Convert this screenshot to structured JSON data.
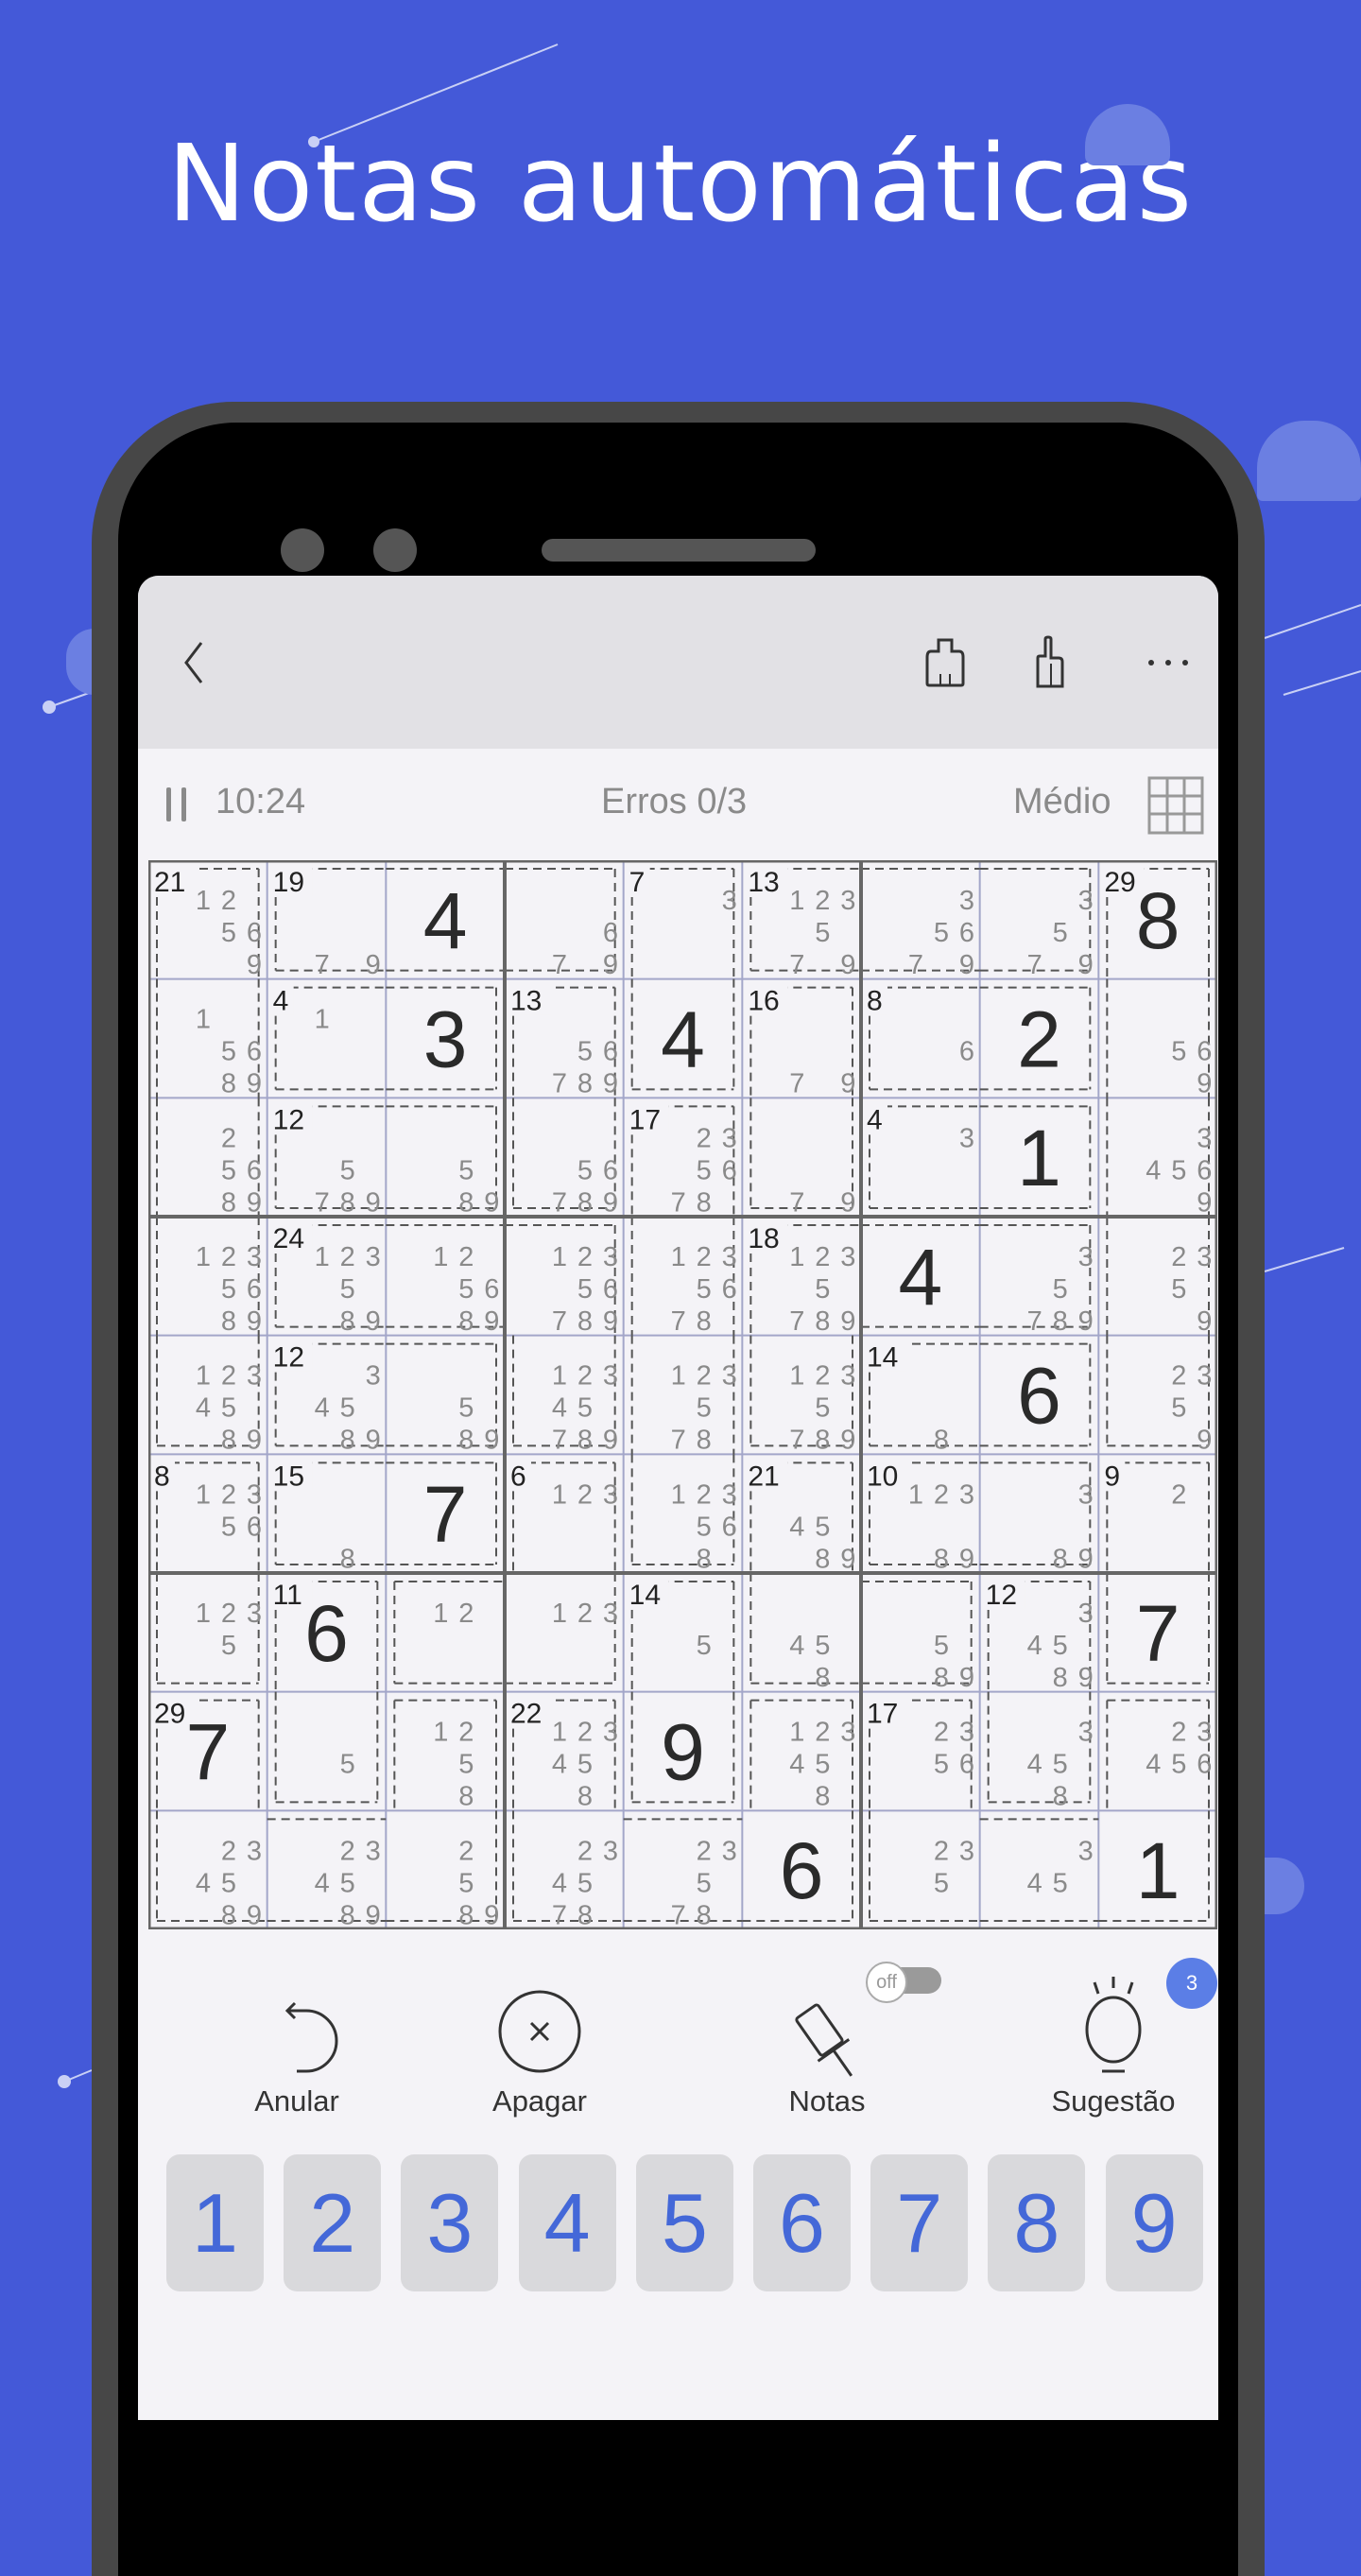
{
  "headline": "Notas automáticas",
  "colors": {
    "background": "#4459d8",
    "accent": "#4468d8",
    "badge": "#5b7ee6"
  },
  "appbar": {
    "icons": [
      "back-chevron-icon",
      "tshirt-theme-icon",
      "trophy-stats-icon",
      "more-dots-icon"
    ]
  },
  "status": {
    "pause_icon": "pause-icon",
    "timer": "10:24",
    "errors": "Erros 0/3",
    "difficulty": "Médio",
    "grid_icon": "grid-icon"
  },
  "board": {
    "values": [
      [
        0,
        0,
        4,
        0,
        0,
        0,
        0,
        0,
        8
      ],
      [
        0,
        0,
        3,
        0,
        4,
        0,
        0,
        2,
        0
      ],
      [
        0,
        0,
        0,
        0,
        0,
        0,
        0,
        1,
        0
      ],
      [
        0,
        0,
        0,
        0,
        0,
        0,
        4,
        0,
        0
      ],
      [
        0,
        0,
        0,
        0,
        0,
        0,
        0,
        6,
        0
      ],
      [
        0,
        0,
        7,
        0,
        0,
        0,
        0,
        0,
        0
      ],
      [
        0,
        6,
        0,
        0,
        0,
        0,
        0,
        0,
        7
      ],
      [
        7,
        0,
        0,
        0,
        9,
        0,
        0,
        0,
        0
      ],
      [
        0,
        0,
        0,
        0,
        0,
        6,
        0,
        0,
        1
      ]
    ],
    "notes": [
      [
        [
          1,
          2,
          5,
          6,
          9
        ],
        [
          7,
          9
        ],
        [],
        [
          6,
          7,
          9
        ],
        [
          3
        ],
        [
          1,
          2,
          3,
          5,
          7,
          9
        ],
        [
          3,
          5,
          6,
          7,
          9
        ],
        [
          3,
          5,
          7,
          9
        ],
        []
      ],
      [
        [
          1,
          5,
          6,
          8,
          9
        ],
        [
          1
        ],
        [],
        [
          5,
          6,
          7,
          8,
          9
        ],
        [],
        [
          7,
          9
        ],
        [
          6
        ],
        [],
        [
          5,
          6,
          9
        ]
      ],
      [
        [
          2,
          5,
          6,
          8,
          9
        ],
        [
          5,
          7,
          8,
          9
        ],
        [
          5,
          8,
          9
        ],
        [
          5,
          6,
          7,
          8,
          9
        ],
        [
          2,
          3,
          5,
          6,
          7,
          8
        ],
        [
          7,
          9
        ],
        [
          3
        ],
        [],
        [
          3,
          4,
          5,
          6,
          9
        ]
      ],
      [
        [
          1,
          2,
          3,
          5,
          6,
          8,
          9
        ],
        [
          1,
          2,
          3,
          5,
          8,
          9
        ],
        [
          1,
          2,
          5,
          6,
          8,
          9
        ],
        [
          1,
          2,
          3,
          5,
          6,
          7,
          8,
          9
        ],
        [
          1,
          2,
          3,
          5,
          6,
          7,
          8
        ],
        [
          1,
          2,
          3,
          5,
          7,
          8,
          9
        ],
        [],
        [
          3,
          5,
          7,
          8,
          9
        ],
        [
          2,
          3,
          5,
          9
        ]
      ],
      [
        [
          1,
          2,
          3,
          4,
          5,
          8,
          9
        ],
        [
          3,
          4,
          5,
          8,
          9
        ],
        [
          5,
          8,
          9
        ],
        [
          1,
          2,
          3,
          4,
          5,
          7,
          8,
          9
        ],
        [
          1,
          2,
          3,
          5,
          7,
          8
        ],
        [
          1,
          2,
          3,
          5,
          7,
          8,
          9
        ],
        [
          8
        ],
        [],
        [
          2,
          3,
          5,
          9
        ]
      ],
      [
        [
          1,
          2,
          3,
          5,
          6
        ],
        [
          8
        ],
        [],
        [
          1,
          2,
          3
        ],
        [
          1,
          2,
          3,
          5,
          6,
          8
        ],
        [
          4,
          5,
          8,
          9
        ],
        [
          1,
          2,
          3,
          8,
          9
        ],
        [
          3,
          8,
          9
        ],
        [
          2
        ]
      ],
      [
        [
          1,
          2,
          3,
          5
        ],
        [],
        [
          1,
          2
        ],
        [
          1,
          2,
          3
        ],
        [
          5
        ],
        [
          4,
          5,
          8
        ],
        [
          5,
          8,
          9
        ],
        [
          3,
          4,
          5,
          8,
          9
        ],
        []
      ],
      [
        [],
        [
          5
        ],
        [
          1,
          2,
          5,
          8
        ],
        [
          1,
          2,
          3,
          4,
          5,
          8
        ],
        [],
        [
          1,
          2,
          3,
          4,
          5,
          8
        ],
        [
          2,
          3,
          5,
          6
        ],
        [
          3,
          4,
          5,
          8
        ],
        [
          2,
          3,
          4,
          5,
          6
        ]
      ],
      [
        [
          2,
          3,
          4,
          5,
          8,
          9
        ],
        [
          2,
          3,
          4,
          5,
          8,
          9
        ],
        [
          2,
          5,
          8,
          9
        ],
        [
          2,
          3,
          4,
          5,
          7,
          8
        ],
        [
          2,
          3,
          5,
          7,
          8
        ],
        [],
        [
          2,
          3,
          5
        ],
        [
          3,
          4,
          5
        ],
        []
      ]
    ],
    "cages": [
      {
        "sum": "21",
        "cells": [
          [
            0,
            0
          ],
          [
            1,
            0
          ],
          [
            2,
            0
          ],
          [
            3,
            0
          ],
          [
            4,
            0
          ]
        ]
      },
      {
        "sum": "19",
        "cells": [
          [
            0,
            1
          ],
          [
            0,
            2
          ],
          [
            0,
            3
          ]
        ]
      },
      {
        "sum": "7",
        "cells": [
          [
            0,
            4
          ],
          [
            1,
            4
          ]
        ]
      },
      {
        "sum": "13",
        "cells": [
          [
            0,
            5
          ],
          [
            0,
            6
          ],
          [
            0,
            7
          ]
        ]
      },
      {
        "sum": "29",
        "cells": [
          [
            0,
            8
          ],
          [
            1,
            8
          ],
          [
            2,
            8
          ],
          [
            3,
            8
          ],
          [
            4,
            8
          ]
        ]
      },
      {
        "sum": "4",
        "cells": [
          [
            1,
            1
          ],
          [
            1,
            2
          ]
        ]
      },
      {
        "sum": "13",
        "cells": [
          [
            1,
            3
          ],
          [
            2,
            3
          ]
        ]
      },
      {
        "sum": "16",
        "cells": [
          [
            1,
            5
          ],
          [
            2,
            5
          ]
        ]
      },
      {
        "sum": "8",
        "cells": [
          [
            1,
            6
          ],
          [
            1,
            7
          ]
        ]
      },
      {
        "sum": "12",
        "cells": [
          [
            2,
            1
          ],
          [
            2,
            2
          ]
        ]
      },
      {
        "sum": "17",
        "cells": [
          [
            2,
            4
          ],
          [
            3,
            4
          ],
          [
            4,
            4
          ],
          [
            5,
            4
          ]
        ]
      },
      {
        "sum": "4",
        "cells": [
          [
            2,
            6
          ],
          [
            2,
            7
          ]
        ]
      },
      {
        "sum": "24",
        "cells": [
          [
            3,
            1
          ],
          [
            3,
            2
          ],
          [
            3,
            3
          ],
          [
            4,
            3
          ]
        ]
      },
      {
        "sum": "18",
        "cells": [
          [
            3,
            5
          ],
          [
            4,
            5
          ],
          [
            3,
            6
          ],
          [
            3,
            7
          ]
        ]
      },
      {
        "sum": "12",
        "cells": [
          [
            4,
            1
          ],
          [
            4,
            2
          ]
        ]
      },
      {
        "sum": "14",
        "cells": [
          [
            4,
            6
          ],
          [
            4,
            7
          ]
        ]
      },
      {
        "sum": "8",
        "cells": [
          [
            5,
            0
          ],
          [
            6,
            0
          ]
        ]
      },
      {
        "sum": "15",
        "cells": [
          [
            5,
            1
          ],
          [
            5,
            2
          ]
        ]
      },
      {
        "sum": "6",
        "cells": [
          [
            5,
            3
          ],
          [
            6,
            3
          ],
          [
            6,
            2
          ]
        ]
      },
      {
        "sum": "21",
        "cells": [
          [
            5,
            5
          ],
          [
            6,
            5
          ],
          [
            6,
            6
          ]
        ]
      },
      {
        "sum": "10",
        "cells": [
          [
            5,
            6
          ],
          [
            5,
            7
          ]
        ]
      },
      {
        "sum": "9",
        "cells": [
          [
            5,
            8
          ],
          [
            6,
            8
          ]
        ]
      },
      {
        "sum": "11",
        "cells": [
          [
            6,
            1
          ],
          [
            7,
            1
          ]
        ]
      },
      {
        "sum": "14",
        "cells": [
          [
            6,
            4
          ],
          [
            7,
            4
          ]
        ]
      },
      {
        "sum": "12",
        "cells": [
          [
            6,
            7
          ],
          [
            7,
            7
          ]
        ]
      },
      {
        "sum": "29",
        "cells": [
          [
            7,
            0
          ],
          [
            8,
            0
          ],
          [
            8,
            1
          ],
          [
            8,
            2
          ],
          [
            7,
            2
          ]
        ]
      },
      {
        "sum": "22",
        "cells": [
          [
            7,
            3
          ],
          [
            8,
            3
          ],
          [
            8,
            4
          ],
          [
            8,
            5
          ],
          [
            7,
            5
          ]
        ]
      },
      {
        "sum": "17",
        "cells": [
          [
            7,
            6
          ],
          [
            8,
            6
          ],
          [
            8,
            7
          ],
          [
            8,
            8
          ],
          [
            7,
            8
          ]
        ]
      }
    ]
  },
  "toolbar": {
    "undo": "Anular",
    "erase": "Apagar",
    "notes": "Notas",
    "notes_toggle": "off",
    "hint": "Sugestão",
    "hint_count": "3"
  },
  "numpad": [
    "1",
    "2",
    "3",
    "4",
    "5",
    "6",
    "7",
    "8",
    "9"
  ]
}
